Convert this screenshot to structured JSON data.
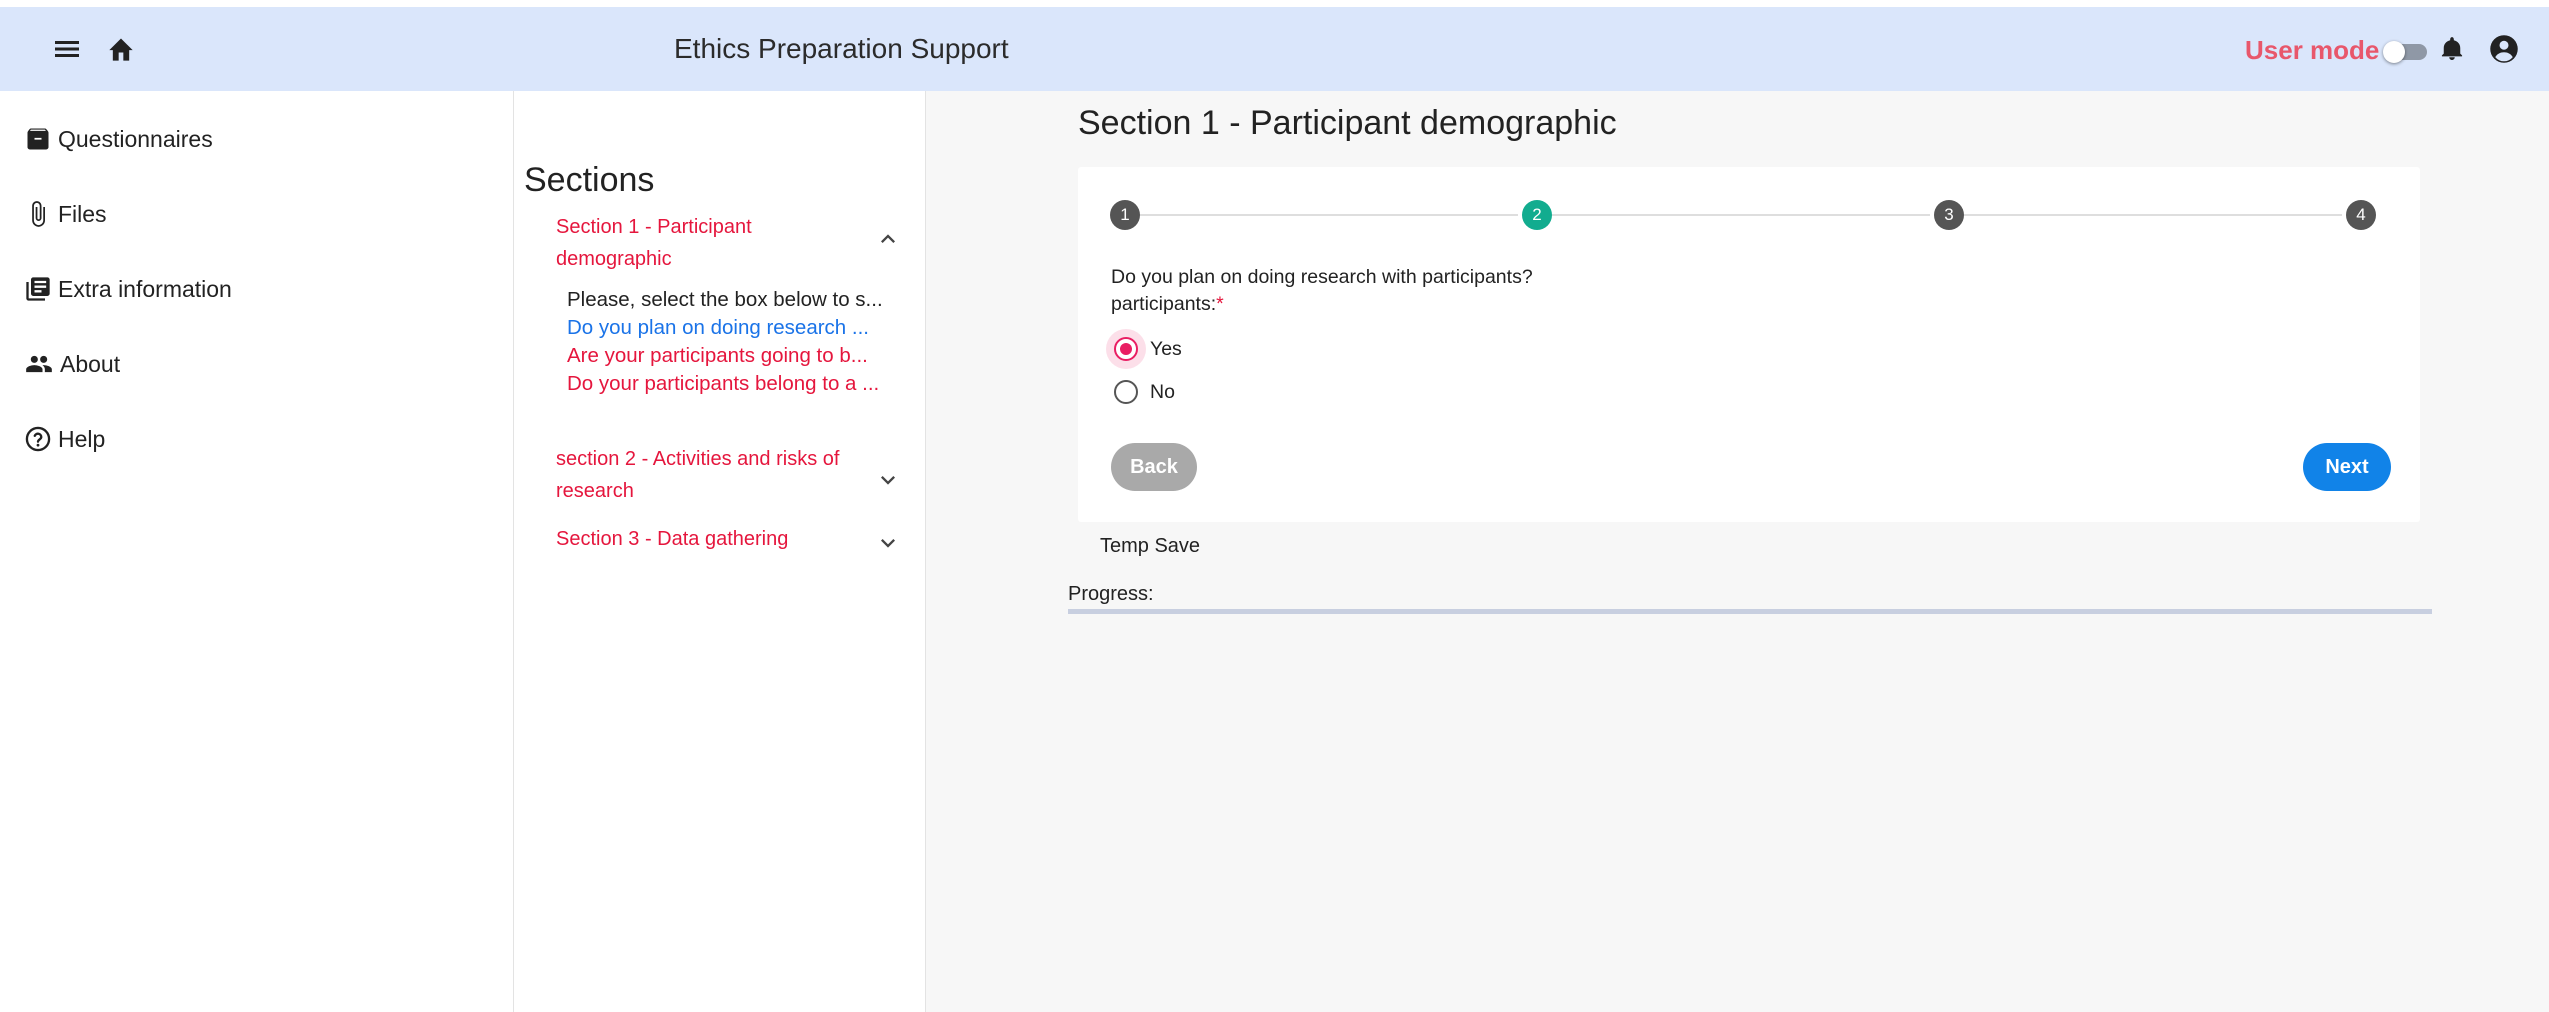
{
  "appbar": {
    "title": "Ethics Preparation Support",
    "mode_label": "User mode",
    "mode_toggle_on": false,
    "accent_color": "#e8576b",
    "icons": [
      "menu-icon",
      "home-icon",
      "bell-icon",
      "account-circle-icon"
    ]
  },
  "nav": {
    "items": [
      {
        "label": "Questionnaires",
        "icon": "archive-box-icon"
      },
      {
        "label": "Files",
        "icon": "paperclip-icon"
      },
      {
        "label": "Extra information",
        "icon": "library-books-icon"
      },
      {
        "label": "About",
        "icon": "people-icon"
      },
      {
        "label": "Help",
        "icon": "help-circle-icon"
      }
    ]
  },
  "sections": {
    "title": "Sections",
    "list": [
      {
        "label": "Section 1 - Participant demographic",
        "expanded": true,
        "items": [
          {
            "label": "Please, select the box below to s...",
            "state": "answered"
          },
          {
            "label": "Do you plan on doing research ...",
            "state": "current"
          },
          {
            "label": "Are your participants going to b...",
            "state": "pending"
          },
          {
            "label": "Do your participants belong to a ...",
            "state": "pending"
          }
        ]
      },
      {
        "label": "section 2 - Activities and risks of research",
        "expanded": false
      },
      {
        "label": "Section 3 - Data gathering",
        "expanded": false
      }
    ],
    "colors": {
      "answered": "#222222",
      "current": "#1a73e8",
      "pending": "#e5163d"
    }
  },
  "main": {
    "section_title": "Section 1 - Participant demographic",
    "stepper": {
      "steps": [
        "1",
        "2",
        "3",
        "4"
      ],
      "active_step": 2,
      "active_color": "#12ac8f",
      "inactive_color": "#555555"
    },
    "question": {
      "line1": "Do you plan on doing research with participants?",
      "line2": "participants:",
      "required_mark": "*"
    },
    "options": [
      {
        "label": "Yes",
        "selected": true
      },
      {
        "label": "No",
        "selected": false
      }
    ],
    "back_label": "Back",
    "next_label": "Next",
    "temp_save_label": "Temp Save",
    "progress_label": "Progress:",
    "progress_value": 0
  }
}
